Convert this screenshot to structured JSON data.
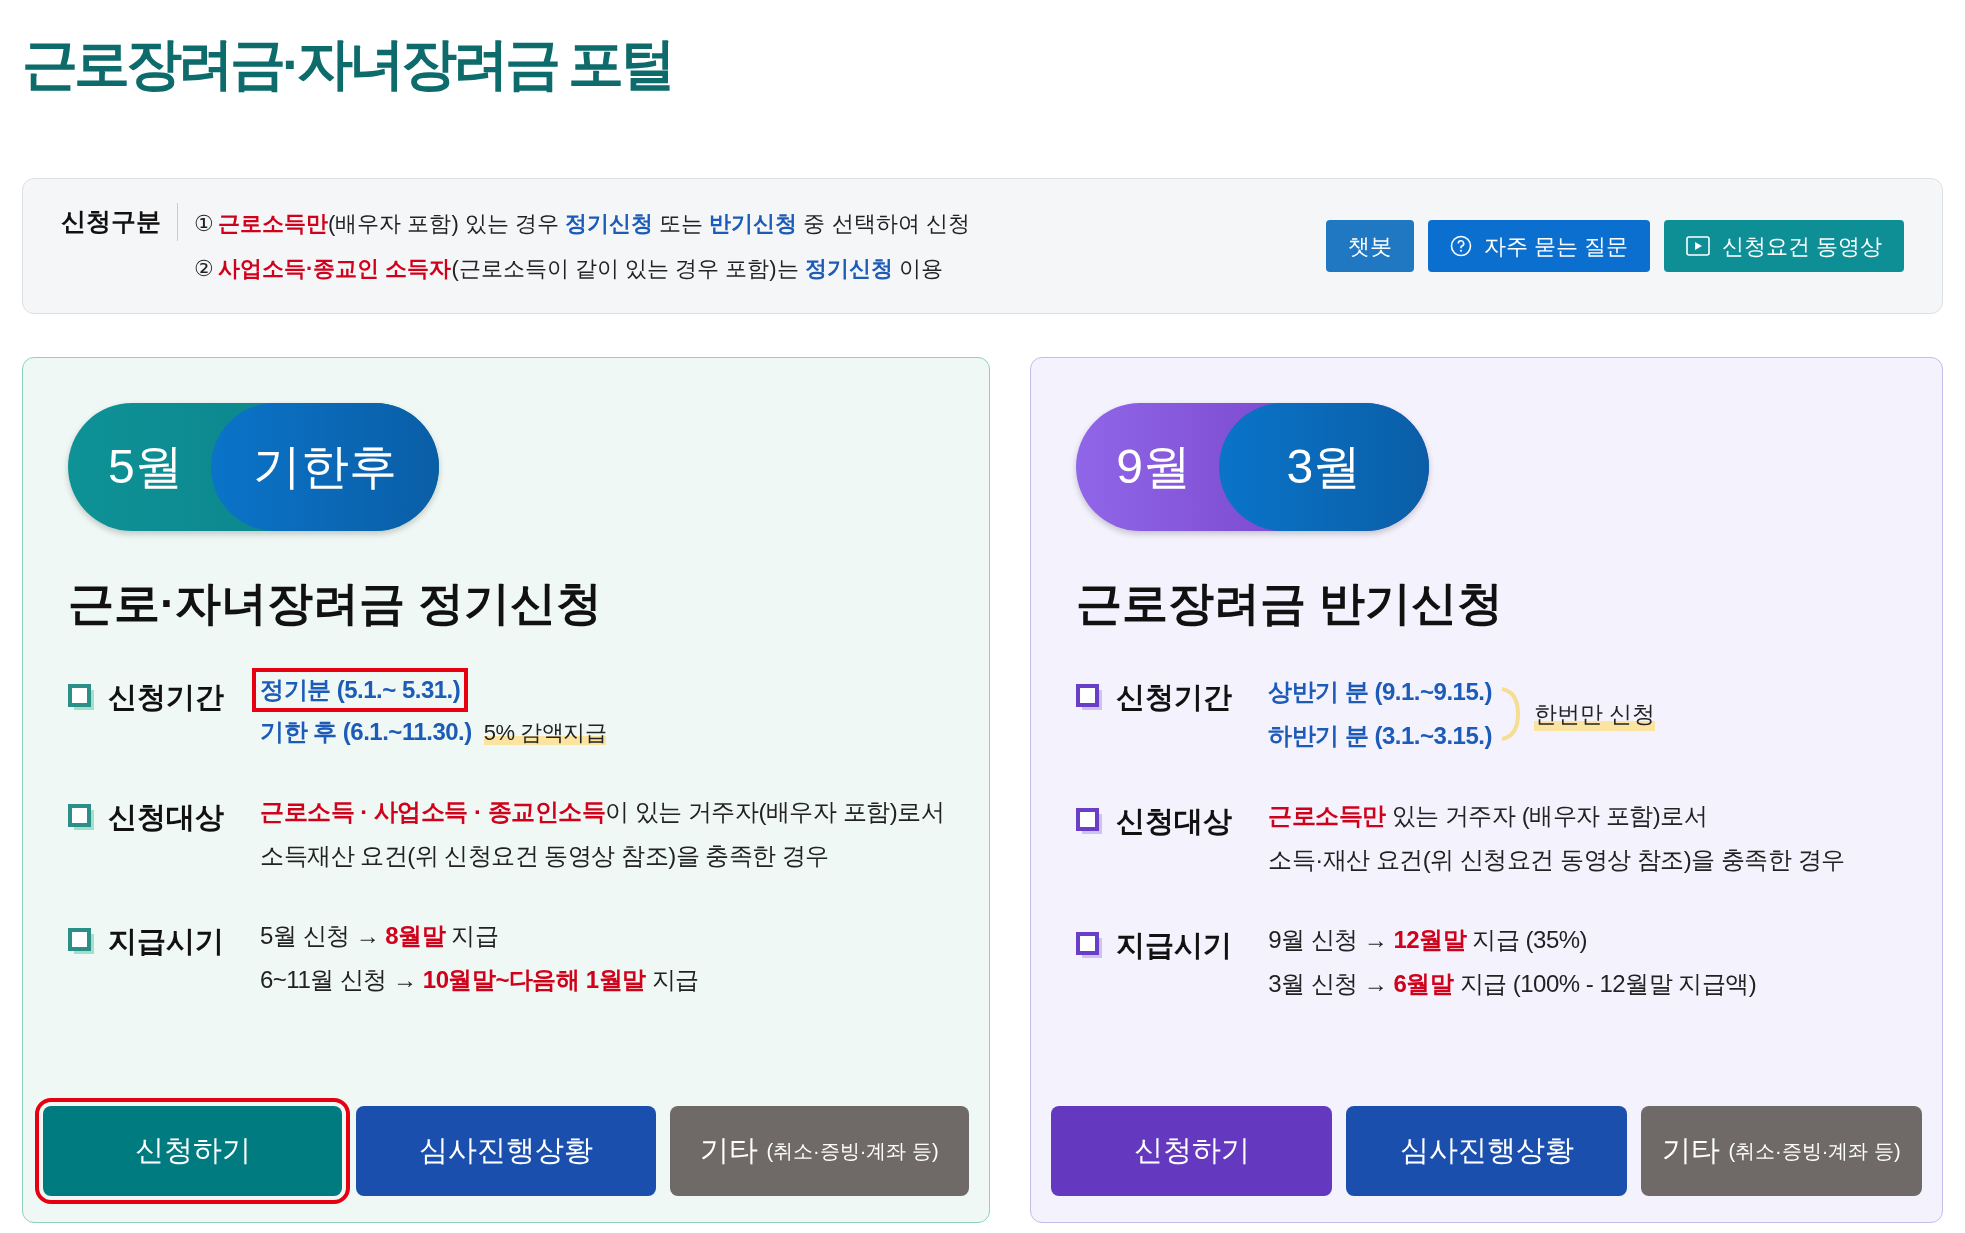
{
  "title": "근로장려금·자녀장려금 포털",
  "notice": {
    "label": "신청구분",
    "lines": [
      {
        "marker": "①",
        "parts": [
          {
            "text": "근로소득만",
            "kind": "red"
          },
          {
            "text": "(배우자 포함) 있는 경우 ",
            "kind": "plain"
          },
          {
            "text": "정기신청",
            "kind": "blue"
          },
          {
            "text": " 또는 ",
            "kind": "plain"
          },
          {
            "text": "반기신청",
            "kind": "blue"
          },
          {
            "text": " 중 선택하여 신청",
            "kind": "plain"
          }
        ]
      },
      {
        "marker": "②",
        "parts": [
          {
            "text": "사업소득·종교인 소득자",
            "kind": "red"
          },
          {
            "text": "(근로소득이 같이 있는 경우 포함)는 ",
            "kind": "plain"
          },
          {
            "text": "정기신청",
            "kind": "blue"
          },
          {
            "text": " 이용",
            "kind": "plain"
          }
        ]
      }
    ],
    "buttons": [
      {
        "label": "챗봇",
        "kind": "chatbot"
      },
      {
        "label": "자주 묻는 질문",
        "kind": "faq"
      },
      {
        "label": "신청요건 동영상",
        "kind": "video"
      }
    ]
  },
  "cards": [
    {
      "kind": "teal",
      "badges": [
        "5월",
        "기한후"
      ],
      "title": "근로·자녀장려금 정기신청",
      "rows": [
        {
          "label": "신청기간",
          "lines": [
            {
              "boxed": true,
              "parts": [
                {
                  "text": "정기분 (5.1.~ 5.31.)",
                  "kind": "blue"
                }
              ]
            },
            {
              "boxed": false,
              "parts": [
                {
                  "text": "기한 후 (6.1.~11.30.)",
                  "kind": "blue"
                },
                {
                  "text": "5% 감액지급",
                  "kind": "note"
                }
              ]
            }
          ]
        },
        {
          "label": "신청대상",
          "lines": [
            {
              "boxed": false,
              "parts": [
                {
                  "text": "근로소득 · 사업소득 · 종교인소득",
                  "kind": "red"
                },
                {
                  "text": "이 있는 거주자(배우자 포함)로서",
                  "kind": "plain"
                }
              ]
            },
            {
              "boxed": false,
              "parts": [
                {
                  "text": "소득재산 요건(위 신청요건 동영상 참조)을 충족한 경우",
                  "kind": "plain"
                }
              ]
            }
          ]
        },
        {
          "label": "지급시기",
          "lines": [
            {
              "boxed": false,
              "parts": [
                {
                  "text": "5월 신청 → ",
                  "kind": "plain"
                },
                {
                  "text": "8월말",
                  "kind": "red"
                },
                {
                  "text": " 지급",
                  "kind": "plain"
                }
              ]
            },
            {
              "boxed": false,
              "parts": [
                {
                  "text": "6~11월 신청 → ",
                  "kind": "plain"
                },
                {
                  "text": "10월말~다음해 1월말",
                  "kind": "red"
                },
                {
                  "text": " 지급",
                  "kind": "plain"
                }
              ]
            }
          ]
        }
      ],
      "buttons": [
        {
          "label": "신청하기",
          "kind": "apply",
          "highlighted": true
        },
        {
          "label": "심사진행상황",
          "kind": "status",
          "highlighted": false
        },
        {
          "label": "기타",
          "sublabel": "(취소·증빙·계좌 등)",
          "kind": "other",
          "highlighted": false
        }
      ]
    },
    {
      "kind": "purple",
      "badges": [
        "9월",
        "3월"
      ],
      "title": "근로장려금 반기신청",
      "rows": [
        {
          "label": "신청기간",
          "note": "한번만 신청",
          "lines": [
            {
              "boxed": false,
              "parts": [
                {
                  "text": "상반기 분 (9.1.~9.15.)",
                  "kind": "blue"
                }
              ]
            },
            {
              "boxed": false,
              "parts": [
                {
                  "text": "하반기 분 (3.1.~3.15.)",
                  "kind": "blue"
                }
              ]
            }
          ]
        },
        {
          "label": "신청대상",
          "lines": [
            {
              "boxed": false,
              "parts": [
                {
                  "text": "근로소득만",
                  "kind": "red"
                },
                {
                  "text": " 있는 거주자 (배우자 포함)로서",
                  "kind": "plain"
                }
              ]
            },
            {
              "boxed": false,
              "parts": [
                {
                  "text": "소득·재산 요건(위 신청요건 동영상 참조)을 충족한 경우",
                  "kind": "plain"
                }
              ]
            }
          ]
        },
        {
          "label": "지급시기",
          "lines": [
            {
              "boxed": false,
              "parts": [
                {
                  "text": "9월 신청 → ",
                  "kind": "plain"
                },
                {
                  "text": "12월말",
                  "kind": "red"
                },
                {
                  "text": " 지급 (35%)",
                  "kind": "plain"
                }
              ]
            },
            {
              "boxed": false,
              "parts": [
                {
                  "text": "3월 신청 → ",
                  "kind": "plain"
                },
                {
                  "text": "6월말",
                  "kind": "red"
                },
                {
                  "text": " 지급 (100% - 12월말 지급액)",
                  "kind": "plain"
                }
              ]
            }
          ]
        }
      ],
      "buttons": [
        {
          "label": "신청하기",
          "kind": "apply",
          "highlighted": false
        },
        {
          "label": "심사진행상황",
          "kind": "status",
          "highlighted": false
        },
        {
          "label": "기타",
          "sublabel": "(취소·증빙·계좌 등)",
          "kind": "other",
          "highlighted": false
        }
      ]
    }
  ]
}
